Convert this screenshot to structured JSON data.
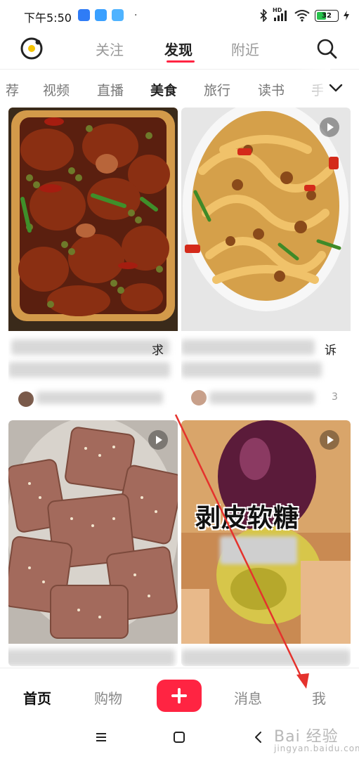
{
  "status_bar": {
    "time": "下午5:50",
    "dot": "·",
    "network": "HD",
    "battery": "32"
  },
  "top_nav": {
    "tabs": [
      {
        "label": "关注",
        "active": false
      },
      {
        "label": "发现",
        "active": true
      },
      {
        "label": "附近",
        "active": false
      }
    ]
  },
  "categories": {
    "items": [
      "荐",
      "视频",
      "直播",
      "美食",
      "旅行",
      "读书",
      "手"
    ],
    "active": "美食"
  },
  "feed": {
    "cards": [
      {
        "title_visible": "求",
        "has_video": false
      },
      {
        "title_visible": "诉",
        "meta_visible": "3",
        "has_video": true
      },
      {
        "has_video": true
      },
      {
        "overlay_text_line1": "剥皮软糖",
        "has_video": true
      }
    ]
  },
  "bottom_tabs": [
    {
      "label": "首页",
      "active": true
    },
    {
      "label": "购物",
      "active": false
    },
    {
      "label": "消息",
      "active": false
    },
    {
      "label": "我",
      "active": false
    }
  ],
  "watermark": {
    "text": "Bai 经验",
    "subtext": "jingyan.baidu.com"
  },
  "colors": {
    "accent": "#ff2442",
    "annotation_arrow": "#e5322d"
  }
}
